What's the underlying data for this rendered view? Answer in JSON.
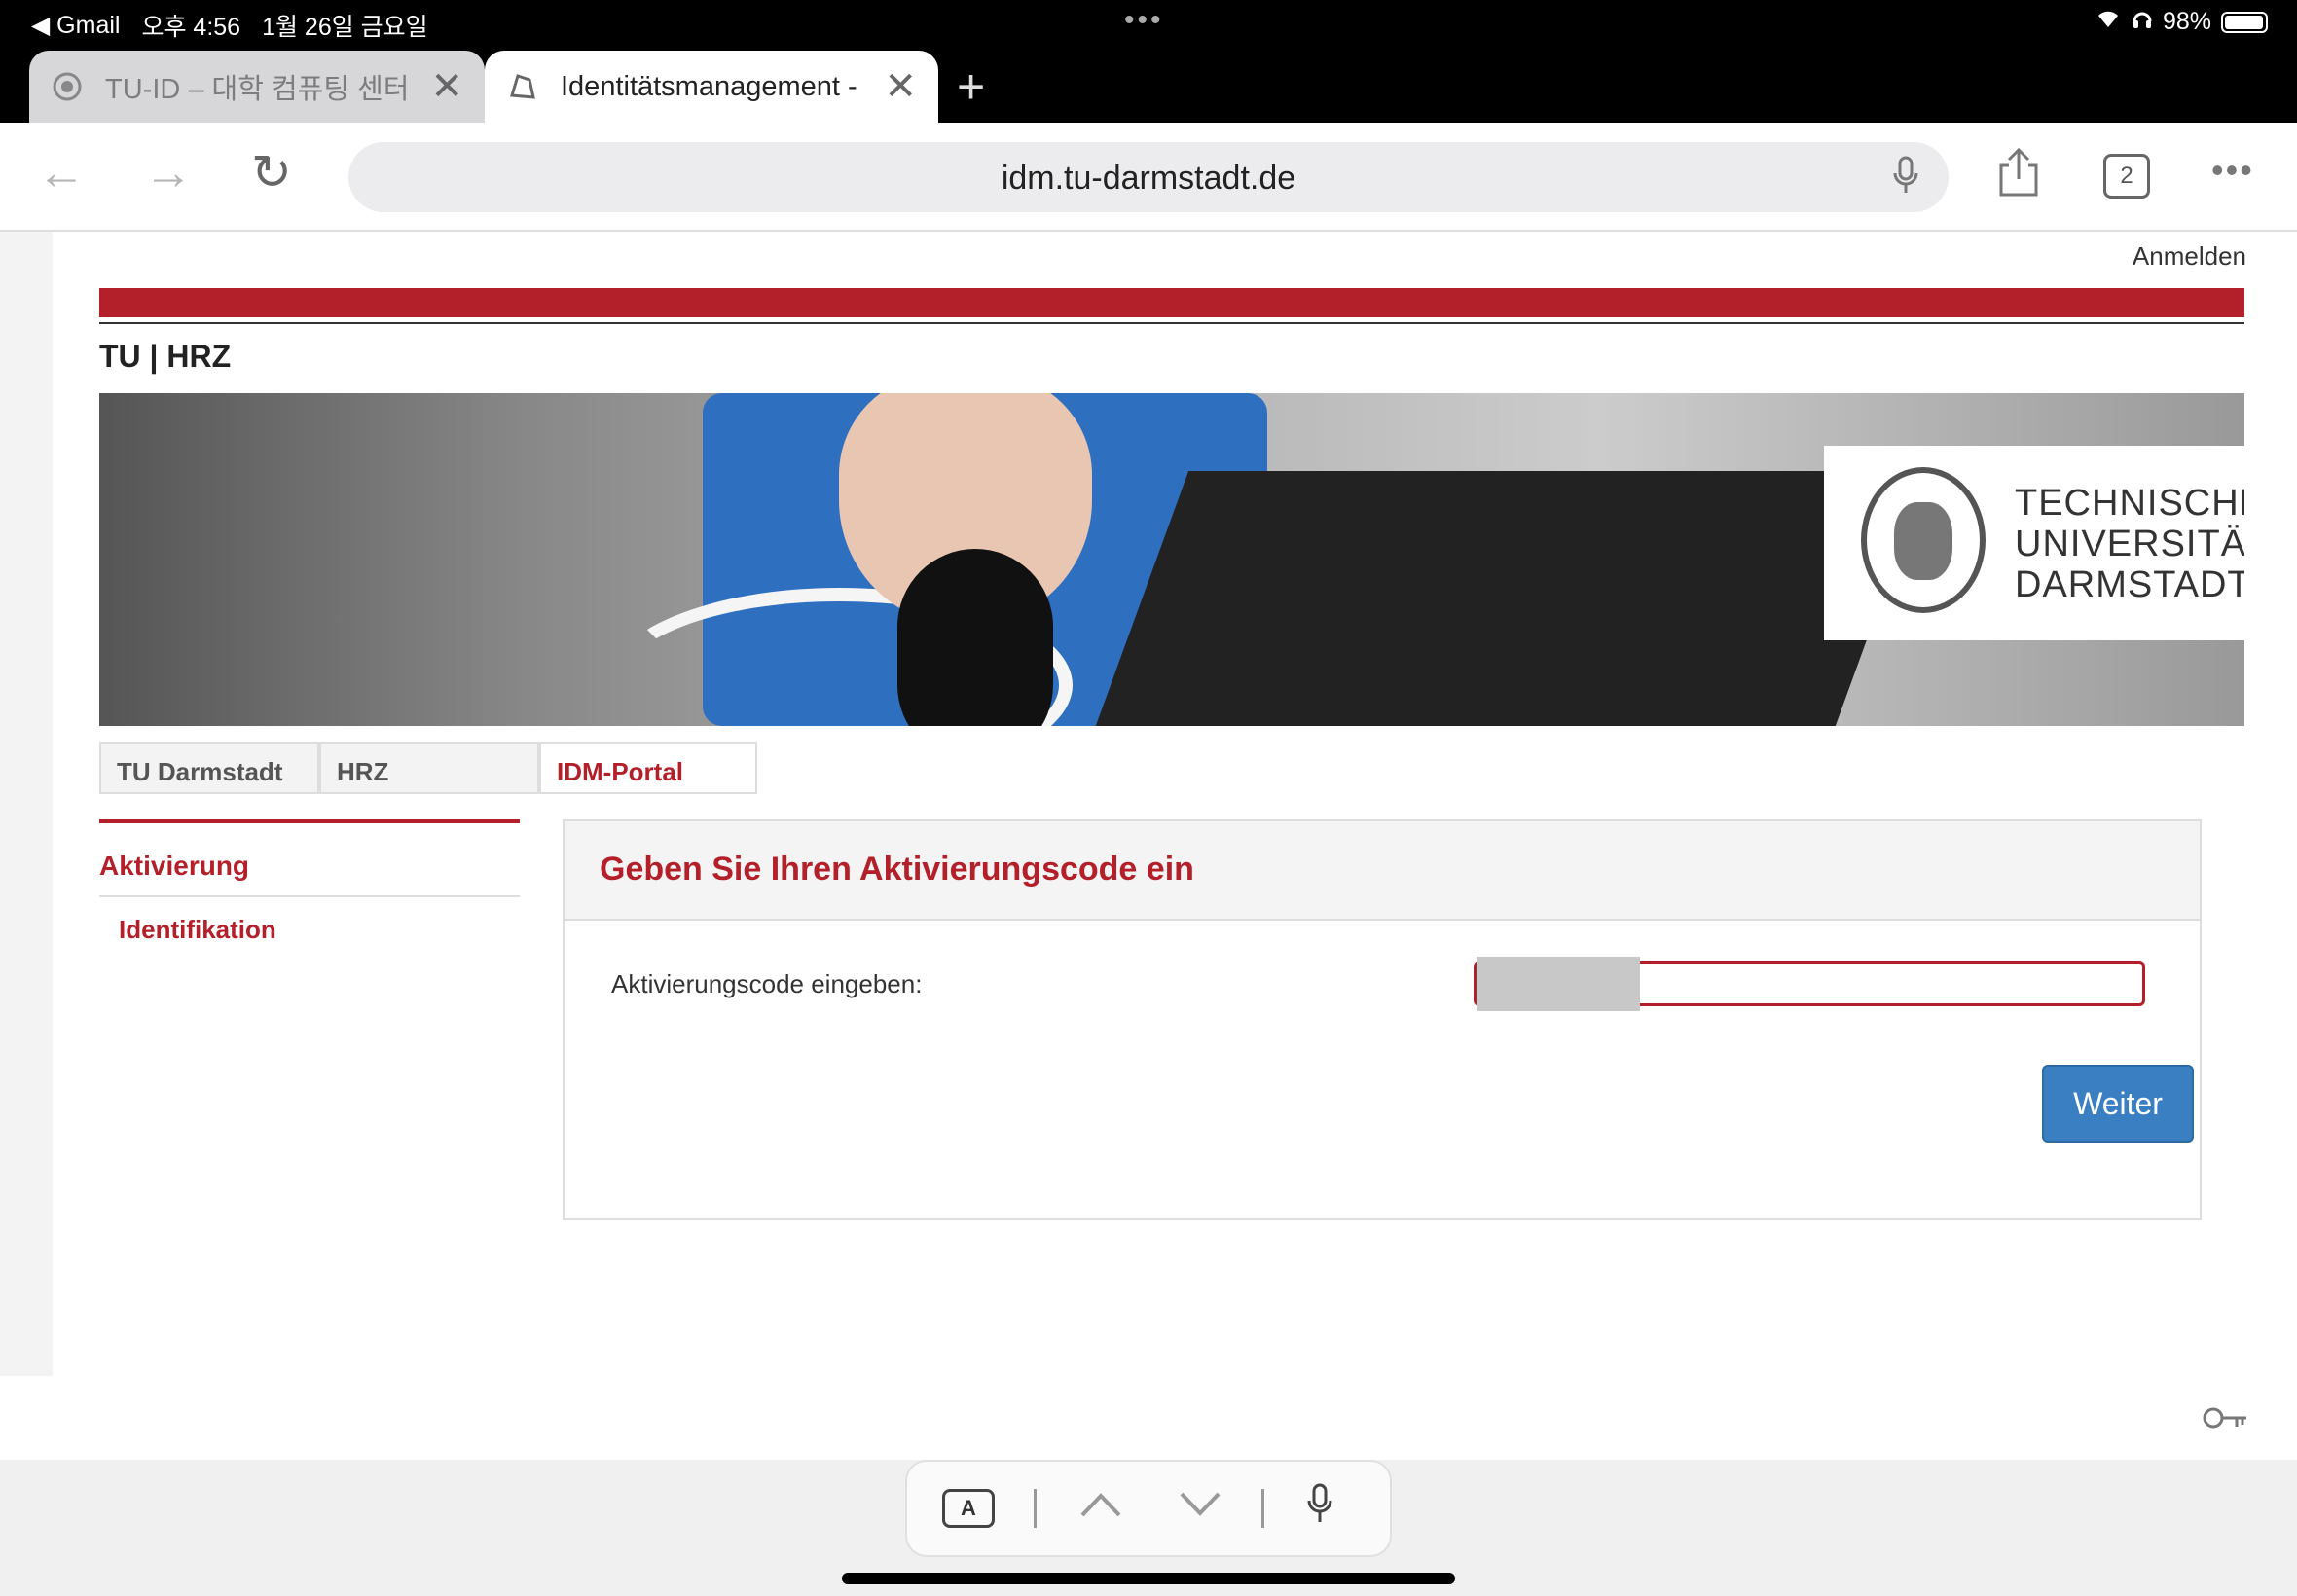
{
  "status": {
    "back_app": "◀ Gmail",
    "time": "오후 4:56",
    "date": "1월 26일 금요일",
    "dots": "•••",
    "battery": "98%"
  },
  "tabs": [
    {
      "title": "TU-ID – 대학 컴퓨팅 센터 –",
      "active": false
    },
    {
      "title": "Identitätsmanagement -",
      "active": true
    }
  ],
  "toolbar": {
    "url": "idm.tu-darmstadt.de",
    "tab_count": "2"
  },
  "page": {
    "signin_label": "Anmelden",
    "site_title": "TU | HRZ",
    "logo_text": "TECHNISCHE\nUNIVERSITÄT\nDARMSTADT",
    "site_tabs": [
      "TU Darmstadt",
      "HRZ",
      "IDM-Portal"
    ],
    "sidebar": {
      "heading": "Aktivierung",
      "items": [
        "Identifikation"
      ]
    },
    "form": {
      "heading": "Geben Sie Ihren Aktivierungscode ein",
      "field_label": "Aktivierungscode eingeben:",
      "field_value": "",
      "submit_label": "Weiter"
    }
  },
  "colors": {
    "brand_red": "#b3202a",
    "button_blue": "#3a7fc1"
  },
  "assist_bar": {
    "format_label": "A"
  }
}
